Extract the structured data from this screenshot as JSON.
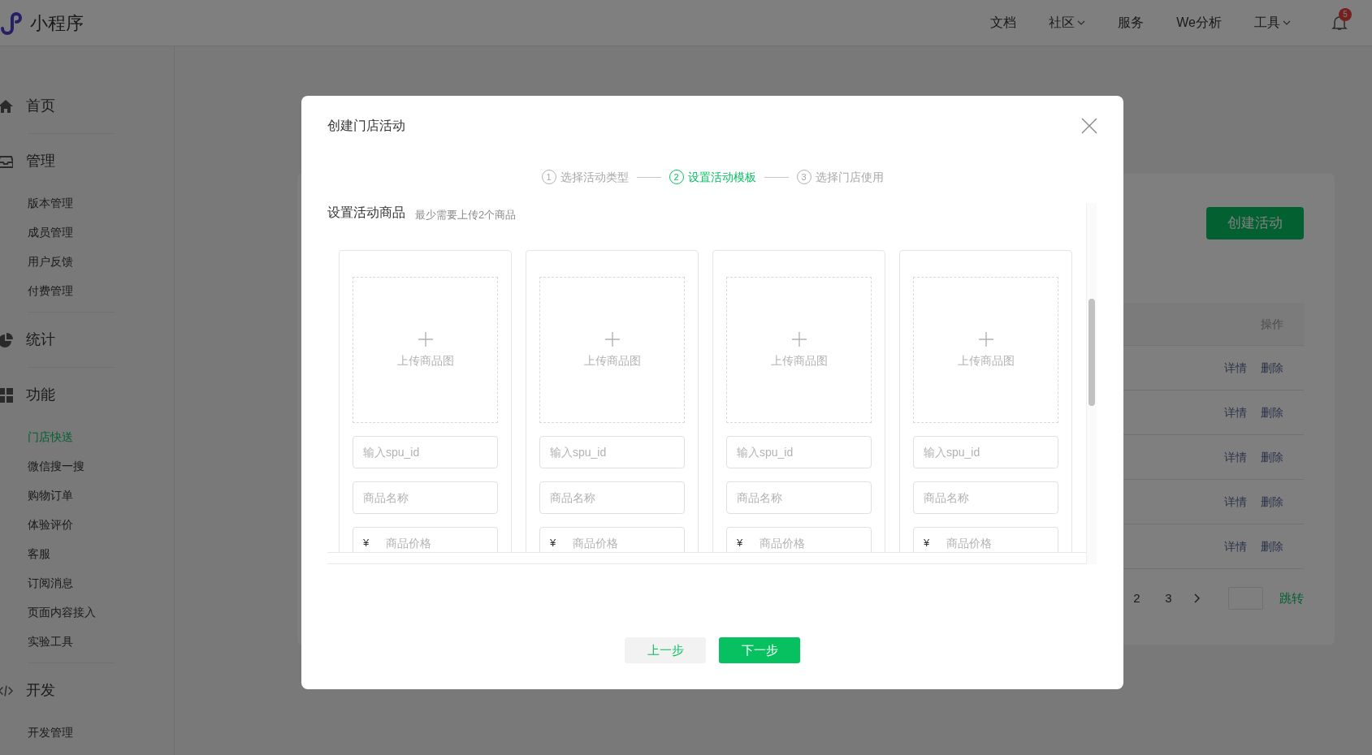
{
  "top_bar": {
    "app_name": "小程序",
    "nav": [
      {
        "label": "文档",
        "dropdown": false
      },
      {
        "label": "社区",
        "dropdown": true
      },
      {
        "label": "服务",
        "dropdown": false
      },
      {
        "label": "We分析",
        "dropdown": false
      },
      {
        "label": "工具",
        "dropdown": true
      }
    ],
    "notification_count": "5"
  },
  "sidebar": {
    "sections": [
      {
        "title": "首页",
        "kind": "home"
      },
      {
        "title": "管理",
        "kind": "inbox",
        "items": [
          {
            "label": "版本管理",
            "selected": false
          },
          {
            "label": "成员管理",
            "selected": false
          },
          {
            "label": "用户反馈",
            "selected": false
          },
          {
            "label": "付费管理",
            "selected": false
          }
        ]
      },
      {
        "title": "统计",
        "kind": "pie"
      },
      {
        "title": "功能",
        "kind": "grid",
        "items": [
          {
            "label": "门店快送",
            "selected": true
          },
          {
            "label": "微信搜一搜",
            "selected": false
          },
          {
            "label": "购物订单",
            "selected": false
          },
          {
            "label": "体验评价",
            "selected": false
          },
          {
            "label": "客服",
            "selected": false
          },
          {
            "label": "订阅消息",
            "selected": false
          },
          {
            "label": "页面内容接入",
            "selected": false
          },
          {
            "label": "实验工具",
            "selected": false
          }
        ]
      },
      {
        "title": "开发",
        "kind": "code",
        "items": [
          {
            "label": "开发管理",
            "selected": false
          }
        ]
      }
    ]
  },
  "page": {
    "create_button": "创建活动",
    "table": {
      "action_header": "操作",
      "rows": [
        {
          "actions": [
            "详情",
            "删除"
          ]
        },
        {
          "actions": [
            "详情",
            "删除"
          ]
        },
        {
          "actions": [
            "详情",
            "删除"
          ]
        },
        {
          "actions": [
            "详情",
            "删除"
          ]
        },
        {
          "actions": [
            "详情",
            "删除"
          ]
        }
      ]
    },
    "pagination": {
      "pages": [
        "2",
        "3"
      ],
      "jump": "跳转"
    }
  },
  "modal": {
    "title": "创建门店活动",
    "steps": [
      {
        "number": "1",
        "label": "选择活动类型",
        "selected": false
      },
      {
        "number": "2",
        "label": "设置活动模板",
        "selected": true
      },
      {
        "number": "3",
        "label": "选择门店使用",
        "selected": false
      }
    ],
    "section_title": "设置活动商品",
    "section_hint": "最少需要上传2个商品",
    "products": [
      {
        "upload_label": "上传商品图",
        "spu_placeholder": "输入spu_id",
        "name_placeholder": "商品名称",
        "currency": "¥",
        "price_placeholder": "商品价格"
      },
      {
        "upload_label": "上传商品图",
        "spu_placeholder": "输入spu_id",
        "name_placeholder": "商品名称",
        "currency": "¥",
        "price_placeholder": "商品价格"
      },
      {
        "upload_label": "上传商品图",
        "spu_placeholder": "输入spu_id",
        "name_placeholder": "商品名称",
        "currency": "¥",
        "price_placeholder": "商品价格"
      },
      {
        "upload_label": "上传商品图",
        "spu_placeholder": "输入spu_id",
        "name_placeholder": "商品名称",
        "currency": "¥",
        "price_placeholder": "商品价格"
      }
    ],
    "prev_button": "上一步",
    "next_button": "下一步"
  }
}
